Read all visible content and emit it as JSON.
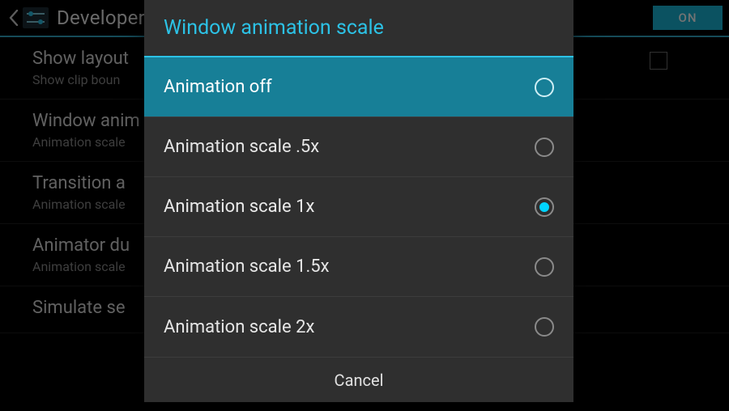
{
  "actionbar": {
    "title": "Developer",
    "toggle_label": "ON"
  },
  "bg_items": [
    {
      "title": "Show layout",
      "subtitle": "Show clip boun",
      "checkbox": true
    },
    {
      "title": "Window anim",
      "subtitle": "Animation scale"
    },
    {
      "title": "Transition a",
      "subtitle": "Animation scale"
    },
    {
      "title": "Animator du",
      "subtitle": "Animation scale"
    },
    {
      "title": "Simulate se",
      "subtitle": ""
    }
  ],
  "dialog": {
    "title": "Window animation scale",
    "options": [
      {
        "label": "Animation off"
      },
      {
        "label": "Animation scale .5x"
      },
      {
        "label": "Animation scale 1x"
      },
      {
        "label": "Animation scale 1.5x"
      },
      {
        "label": "Animation scale 2x"
      }
    ],
    "highlighted_index": 0,
    "selected_index": 2,
    "cancel": "Cancel"
  }
}
